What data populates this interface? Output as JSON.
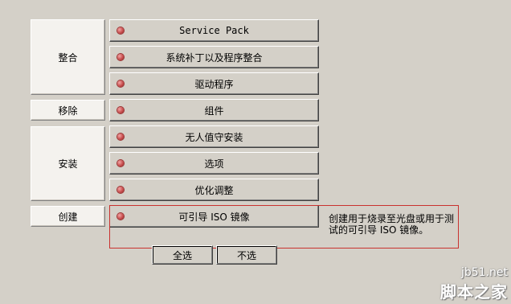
{
  "groups": {
    "integrate": "整合",
    "remove": "移除",
    "setup": "安装",
    "create": "创建"
  },
  "tasks": [
    {
      "label": "Service Pack"
    },
    {
      "label": "系统补丁以及程序整合"
    },
    {
      "label": "驱动程序"
    },
    {
      "label": "组件"
    },
    {
      "label": "无人值守安装"
    },
    {
      "label": "选项"
    },
    {
      "label": "优化调整"
    },
    {
      "label": "可引导 ISO 镜像"
    }
  ],
  "description": "创建用于烧录至光盘或用于测试的可引导 ISO 镜像。",
  "buttons": {
    "select_all": "全选",
    "select_none": "不选"
  },
  "watermark": {
    "site": "jb51.net",
    "brand": "脚本之家"
  },
  "colors": {
    "background": "#d4d0c8",
    "panel": "#f4f2ee",
    "highlight_border": "#c9322f",
    "bullet": "#c44848"
  }
}
